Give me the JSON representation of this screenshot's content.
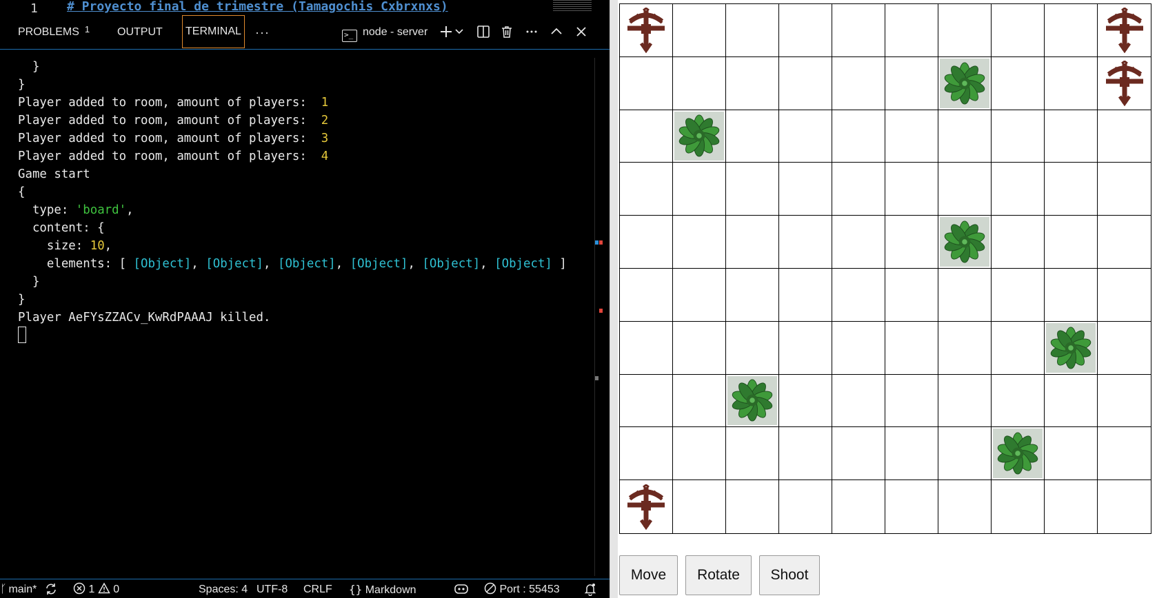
{
  "editor": {
    "line_number": "1",
    "line_text": "# Proyecto final de trimestre (Tamagochis Cxbrxnxs)"
  },
  "panel": {
    "tabs": [
      {
        "label": "PROBLEMS",
        "badge": "1"
      },
      {
        "label": "OUTPUT"
      },
      {
        "label": "TERMINAL",
        "active": true
      }
    ],
    "more_label": "···",
    "terminal_name": "node - server",
    "terminal_icon_glyph": ">_"
  },
  "terminal": {
    "lines": [
      {
        "indent": "  ",
        "parts": [
          {
            "t": "}",
            "c": ""
          }
        ]
      },
      {
        "indent": "",
        "parts": [
          {
            "t": "}",
            "c": ""
          }
        ]
      },
      {
        "indent": "",
        "parts": [
          {
            "t": "Player added to room, amount of players:  ",
            "c": ""
          },
          {
            "t": "1",
            "c": "num"
          }
        ]
      },
      {
        "indent": "",
        "parts": [
          {
            "t": "Player added to room, amount of players:  ",
            "c": ""
          },
          {
            "t": "2",
            "c": "num"
          }
        ]
      },
      {
        "indent": "",
        "parts": [
          {
            "t": "Player added to room, amount of players:  ",
            "c": ""
          },
          {
            "t": "3",
            "c": "num"
          }
        ]
      },
      {
        "indent": "",
        "parts": [
          {
            "t": "Player added to room, amount of players:  ",
            "c": ""
          },
          {
            "t": "4",
            "c": "num"
          }
        ]
      },
      {
        "indent": "",
        "parts": [
          {
            "t": "Game start",
            "c": ""
          }
        ]
      },
      {
        "indent": "",
        "parts": [
          {
            "t": "{",
            "c": ""
          }
        ]
      },
      {
        "indent": "  ",
        "parts": [
          {
            "t": "type: ",
            "c": ""
          },
          {
            "t": "'board'",
            "c": "str"
          },
          {
            "t": ",",
            "c": ""
          }
        ]
      },
      {
        "indent": "  ",
        "parts": [
          {
            "t": "content: {",
            "c": ""
          }
        ]
      },
      {
        "indent": "    ",
        "parts": [
          {
            "t": "size: ",
            "c": ""
          },
          {
            "t": "10",
            "c": "num"
          },
          {
            "t": ",",
            "c": ""
          }
        ]
      },
      {
        "indent": "    ",
        "parts": [
          {
            "t": "elements: [ ",
            "c": ""
          },
          {
            "t": "[Object]",
            "c": "obj"
          },
          {
            "t": ", ",
            "c": ""
          },
          {
            "t": "[Object]",
            "c": "obj"
          },
          {
            "t": ", ",
            "c": ""
          },
          {
            "t": "[Object]",
            "c": "obj"
          },
          {
            "t": ", ",
            "c": ""
          },
          {
            "t": "[Object]",
            "c": "obj"
          },
          {
            "t": ", ",
            "c": ""
          },
          {
            "t": "[Object]",
            "c": "obj"
          },
          {
            "t": ", ",
            "c": ""
          },
          {
            "t": "[Object]",
            "c": "obj"
          },
          {
            "t": " ]",
            "c": ""
          }
        ]
      },
      {
        "indent": "  ",
        "parts": [
          {
            "t": "}",
            "c": ""
          }
        ]
      },
      {
        "indent": "",
        "parts": [
          {
            "t": "}",
            "c": ""
          }
        ]
      },
      {
        "indent": "",
        "parts": [
          {
            "t": "Player AeFYsZZACv_KwRdPAAAJ killed.",
            "c": ""
          }
        ]
      }
    ]
  },
  "statusbar": {
    "branch": "main*",
    "errors": "1",
    "warnings": "0",
    "spaces": "Spaces: 4",
    "encoding": "UTF-8",
    "eol": "CRLF",
    "language": "Markdown",
    "port": "Port : 55453"
  },
  "board": {
    "size": 10,
    "players": [
      [
        0,
        0
      ],
      [
        0,
        9
      ],
      [
        1,
        9
      ],
      [
        9,
        0
      ]
    ],
    "bushes": [
      [
        1,
        6
      ],
      [
        2,
        1
      ],
      [
        4,
        6
      ],
      [
        6,
        8
      ],
      [
        7,
        2
      ],
      [
        8,
        7
      ]
    ]
  },
  "controls": {
    "move": "Move",
    "rotate": "Rotate",
    "shoot": "Shoot"
  },
  "colors": {
    "terminal_bg": "#000000",
    "accent_border": "#1e6fb0",
    "active_tab_border": "#e08a2d",
    "player": "#6b2a20",
    "bush": "#2f7a2f"
  }
}
